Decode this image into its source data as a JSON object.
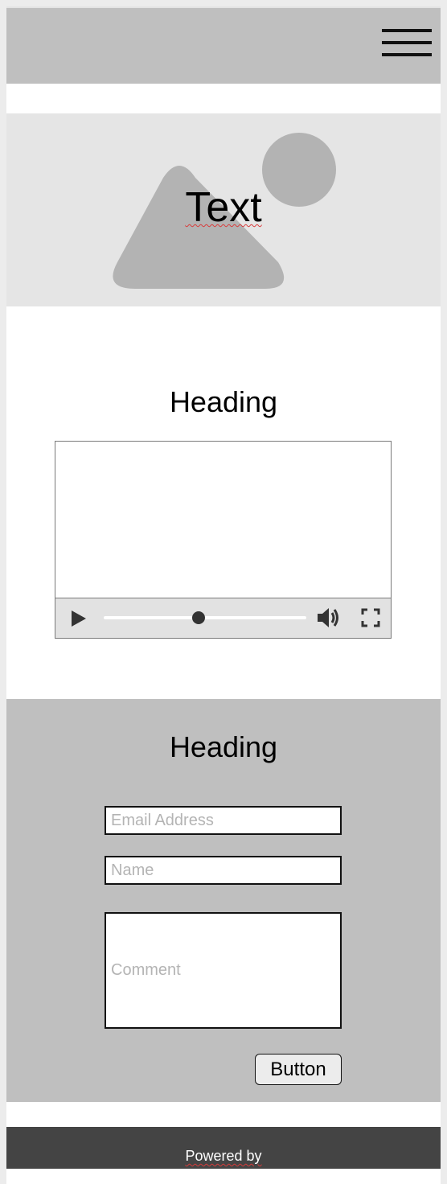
{
  "header": {
    "menu_icon": "hamburger-menu-icon"
  },
  "hero": {
    "image_icon": "image-placeholder-icon",
    "text": "Text"
  },
  "video_section": {
    "heading": "Heading",
    "player": {
      "play_icon": "play-icon",
      "volume_icon": "volume-icon",
      "fullscreen_icon": "fullscreen-icon",
      "progress": 0.47
    }
  },
  "form_section": {
    "heading": "Heading",
    "email": {
      "placeholder": "Email Address",
      "value": ""
    },
    "name": {
      "placeholder": "Name",
      "value": ""
    },
    "comment": {
      "placeholder": "Comment",
      "value": ""
    },
    "button_label": "Button"
  },
  "footer": {
    "text": "Powered by"
  },
  "colors": {
    "header_bg": "#bfbfbf",
    "hero_bg": "#e5e5e5",
    "form_bg": "#bfbfbf",
    "footer_bg": "#444444"
  }
}
